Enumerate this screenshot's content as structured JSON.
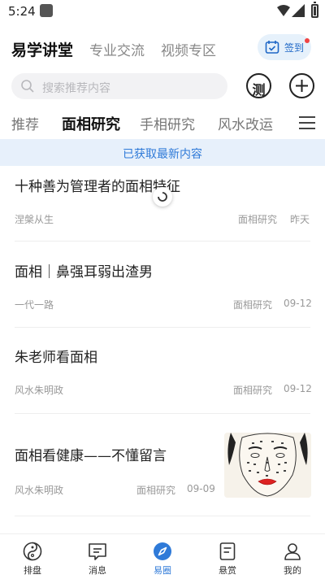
{
  "status_bar": {
    "time": "5:24"
  },
  "top_nav": {
    "tabs": [
      {
        "label": "易学讲堂",
        "active": true
      },
      {
        "label": "专业交流",
        "active": false
      },
      {
        "label": "视频专区",
        "active": false
      }
    ],
    "checkin_label": "签到"
  },
  "search": {
    "placeholder": "搜索推荐内容"
  },
  "actions": {
    "measure_label": "测"
  },
  "categories": [
    {
      "label": "推荐",
      "active": false
    },
    {
      "label": "面相研究",
      "active": true
    },
    {
      "label": "手相研究",
      "active": false
    },
    {
      "label": "风水改运",
      "active": false
    }
  ],
  "banner": {
    "text": "已获取最新内容"
  },
  "feed": [
    {
      "title": "十种善为管理者的面相特征",
      "author": "涅槃从生",
      "tag": "面相研究",
      "date": "昨天"
    },
    {
      "title": "面相｜鼻强耳弱出渣男",
      "author": "一代一路",
      "tag": "面相研究",
      "date": "09-12"
    },
    {
      "title": "朱老师看面相",
      "author": "风水朱明政",
      "tag": "面相研究",
      "date": "09-12"
    },
    {
      "title": "面相看健康——不懂留言",
      "author": "风水朱明政",
      "tag": "面相研究",
      "date": "09-09"
    }
  ],
  "bottom_nav": [
    {
      "label": "排盘",
      "icon": "yin-yang-icon",
      "active": false
    },
    {
      "label": "消息",
      "icon": "message-icon",
      "active": false
    },
    {
      "label": "易圈",
      "icon": "compass-icon",
      "active": true
    },
    {
      "label": "悬赏",
      "icon": "document-icon",
      "active": false
    },
    {
      "label": "我的",
      "icon": "person-icon",
      "active": false
    }
  ],
  "colors": {
    "accent": "#2f7ad8",
    "checkin_bg": "#e6f1fb",
    "banner_bg": "#e7f0fb",
    "badge": "#f04343"
  }
}
